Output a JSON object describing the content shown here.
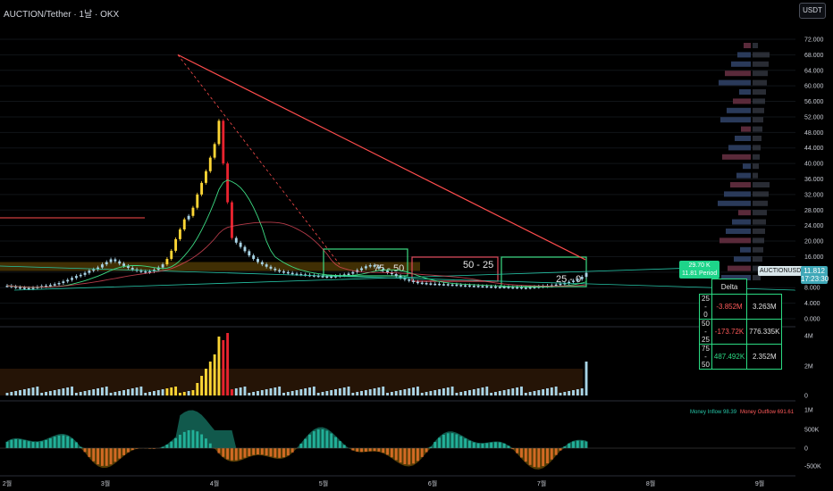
{
  "header": {
    "title": "AUCTION/Tether · 1날 · OKX",
    "currency": "USDT"
  },
  "price_tag": {
    "value": "11.812",
    "timer": "17:23:30"
  },
  "symbol_tag": "AUCTIONUSDT",
  "vpd_tag": {
    "line1": "29.70 K",
    "line2": "11.81 Period"
  },
  "zones": [
    {
      "label": "75 - 50",
      "color": "#3ddc84"
    },
    {
      "label": "50 - 25",
      "color": "#e24a5b"
    },
    {
      "label": "25 - 0",
      "color": "#3ddc84"
    }
  ],
  "delta_table": {
    "header": "Delta",
    "rows": [
      {
        "range": "25 - 0",
        "delta": "-3.852M",
        "volume": "3.263M",
        "sign": "neg"
      },
      {
        "range": "50 - 25",
        "delta": "-173.72K",
        "volume": "776.335K",
        "sign": "neg"
      },
      {
        "range": "75 - 50",
        "delta": "487.492K",
        "volume": "2.352M",
        "sign": "pos"
      }
    ]
  },
  "money_flow": {
    "inflow": "Money Inflow 98.39",
    "outflow": "Money Outflow 691.61"
  },
  "colors": {
    "up": "#fcd535",
    "down": "#e8232f",
    "neutral": "#a8d4e6",
    "accent": "#3ddc84",
    "trend": "#ff4d4d",
    "teal": "#26c6a8"
  },
  "chart_data": [
    {
      "type": "candlestick",
      "title": "",
      "ylabel": "USDT",
      "ylim": [
        0,
        72
      ],
      "yticks": [
        "72.000",
        "68.000",
        "64.000",
        "60.000",
        "56.000",
        "52.000",
        "48.000",
        "44.000",
        "40.000",
        "36.000",
        "32.000",
        "28.000",
        "24.000",
        "20.000",
        "16.000",
        "12.000",
        "8.000",
        "4.000",
        "0.000"
      ],
      "x_ticks": [
        "2월",
        "3월",
        "4월",
        "5월",
        "6월",
        "7월",
        "8월",
        "9월"
      ],
      "candle_closes": [
        8.5,
        8.3,
        8.1,
        8.0,
        7.9,
        7.8,
        8.0,
        8.2,
        8.4,
        8.5,
        8.7,
        8.9,
        9.2,
        9.6,
        10.0,
        10.5,
        11.0,
        11.3,
        11.8,
        12.4,
        12.7,
        13.2,
        14.0,
        14.6,
        15.3,
        14.8,
        14.2,
        13.6,
        13.1,
        12.7,
        12.4,
        12.2,
        12.0,
        12.2,
        12.6,
        13.2,
        14.0,
        15.4,
        17.5,
        20.5,
        23.0,
        25.6,
        26.5,
        28.6,
        32.0,
        35.0,
        38.0,
        41.5,
        45.0,
        51.0,
        40.0,
        30.0,
        20.8,
        19.6,
        18.5,
        17.4,
        16.3,
        15.4,
        14.6,
        14.0,
        13.4,
        12.9,
        12.5,
        12.2,
        12.0,
        11.8,
        11.6,
        11.5,
        11.4,
        11.3,
        11.2,
        11.1,
        11.0,
        10.9,
        10.8,
        10.9,
        11.0,
        11.2,
        11.4,
        11.6,
        12.0,
        12.5,
        13.0,
        13.5,
        13.8,
        13.4,
        12.9,
        12.4,
        11.9,
        11.5,
        11.0,
        10.5,
        10.1,
        9.8,
        9.5,
        9.3,
        9.2,
        9.1,
        9.0,
        9.0,
        8.9,
        8.9,
        8.8,
        8.8,
        8.7,
        8.6,
        8.6,
        8.5,
        8.5,
        8.4,
        8.4,
        8.3,
        8.3,
        8.2,
        8.2,
        8.2,
        8.1,
        8.1,
        8.1,
        8.0,
        8.0,
        8.1,
        8.2,
        8.3,
        8.4,
        8.5,
        8.6,
        8.8,
        9.0,
        9.2,
        9.5,
        9.8,
        10.2,
        10.8,
        11.8
      ],
      "key_levels": {
        "horizontal_red": 26.0,
        "box_low": 12.3,
        "box_high": 14.6
      },
      "trendline_start": 68.0,
      "trendline_end": 15.2,
      "volume_ticks": [
        "4M",
        "2M",
        "0"
      ],
      "mfi_ticks": [
        "1M",
        "500K",
        "0",
        "-500K"
      ]
    }
  ]
}
